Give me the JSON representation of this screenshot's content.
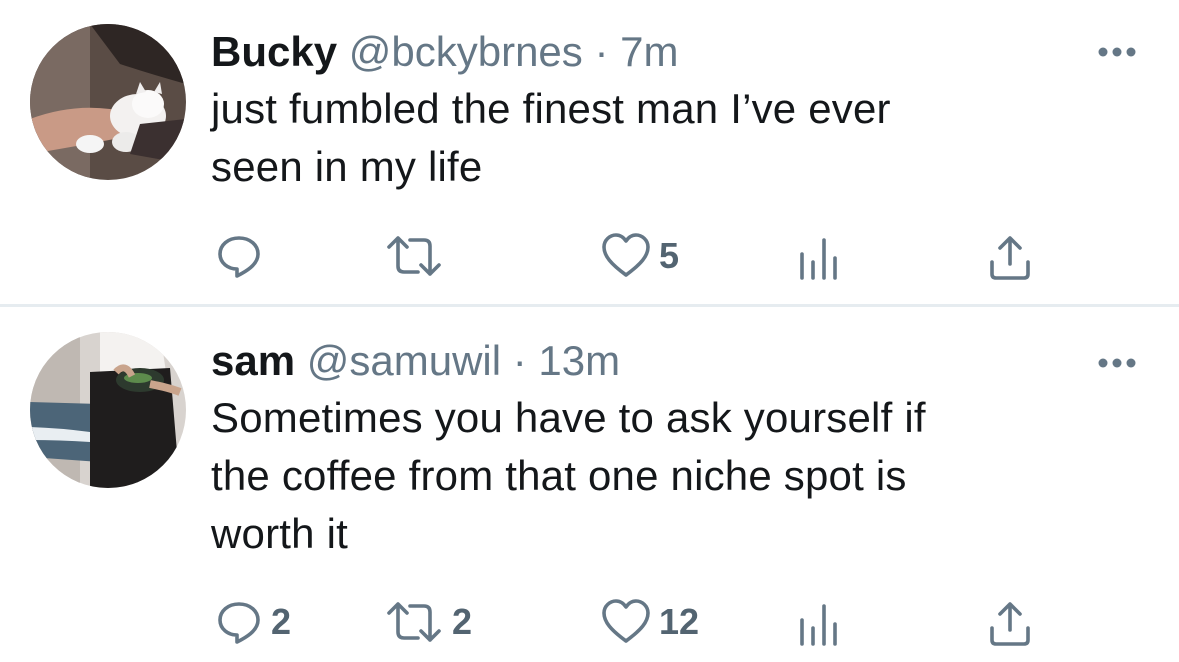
{
  "tweets": [
    {
      "name": "Bucky",
      "handle": "@bckybrnes",
      "separator": "·",
      "time": "7m",
      "text_lines": [
        "just fumbled the finest man I’ve ever",
        "seen in my life"
      ],
      "avatar_icon": "avatar-photo-white-kitten",
      "more_icon": "more-options-icon",
      "actions": {
        "reply": "",
        "retweet": "",
        "like": "5",
        "analytics": "",
        "share": ""
      }
    },
    {
      "name": "sam",
      "handle": "@samuwil",
      "separator": "·",
      "time": "13m",
      "text_lines": [
        "Sometimes you have to ask yourself if",
        "the coffee from that one niche spot is",
        "worth it"
      ],
      "avatar_icon": "avatar-photo-person-with-bowl",
      "more_icon": "more-options-icon",
      "actions": {
        "reply": "2",
        "retweet": "2",
        "like": "12",
        "analytics": "",
        "share": ""
      }
    }
  ],
  "colors": {
    "text": "#14171a",
    "secondary": "#657786",
    "divider": "#e6ecf0"
  }
}
